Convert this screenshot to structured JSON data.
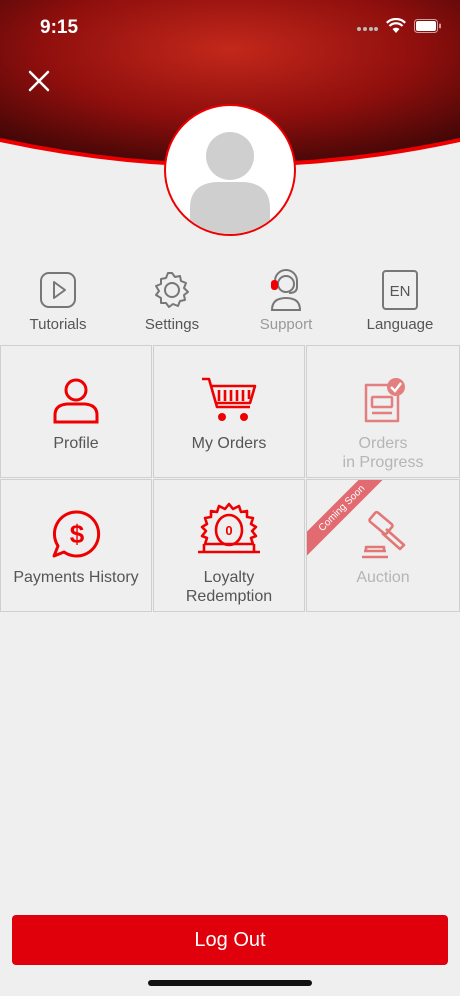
{
  "status": {
    "time": "9:15"
  },
  "colors": {
    "accent": "#e0000b",
    "header": "#8c0f0c"
  },
  "quick_actions": [
    {
      "label": "Tutorials",
      "icon": "play-icon"
    },
    {
      "label": "Settings",
      "icon": "gear-icon"
    },
    {
      "label": "Support",
      "icon": "headset-icon"
    },
    {
      "label": "Language",
      "icon": "language-icon",
      "badge": "EN"
    }
  ],
  "menu": [
    {
      "label": "Profile",
      "icon": "user-icon"
    },
    {
      "label": "My Orders",
      "icon": "cart-icon"
    },
    {
      "label": "Orders\nin Progress",
      "icon": "orders-progress-icon",
      "disabled": true
    },
    {
      "label": "Payments History",
      "icon": "dollar-bubble-icon"
    },
    {
      "label": "Loyalty\nRedemption",
      "icon": "loyalty-gauge-icon",
      "value": "0"
    },
    {
      "label": "Auction",
      "icon": "gavel-icon",
      "disabled": true,
      "ribbon": "Coming Soon"
    }
  ],
  "logout_label": "Log Out"
}
